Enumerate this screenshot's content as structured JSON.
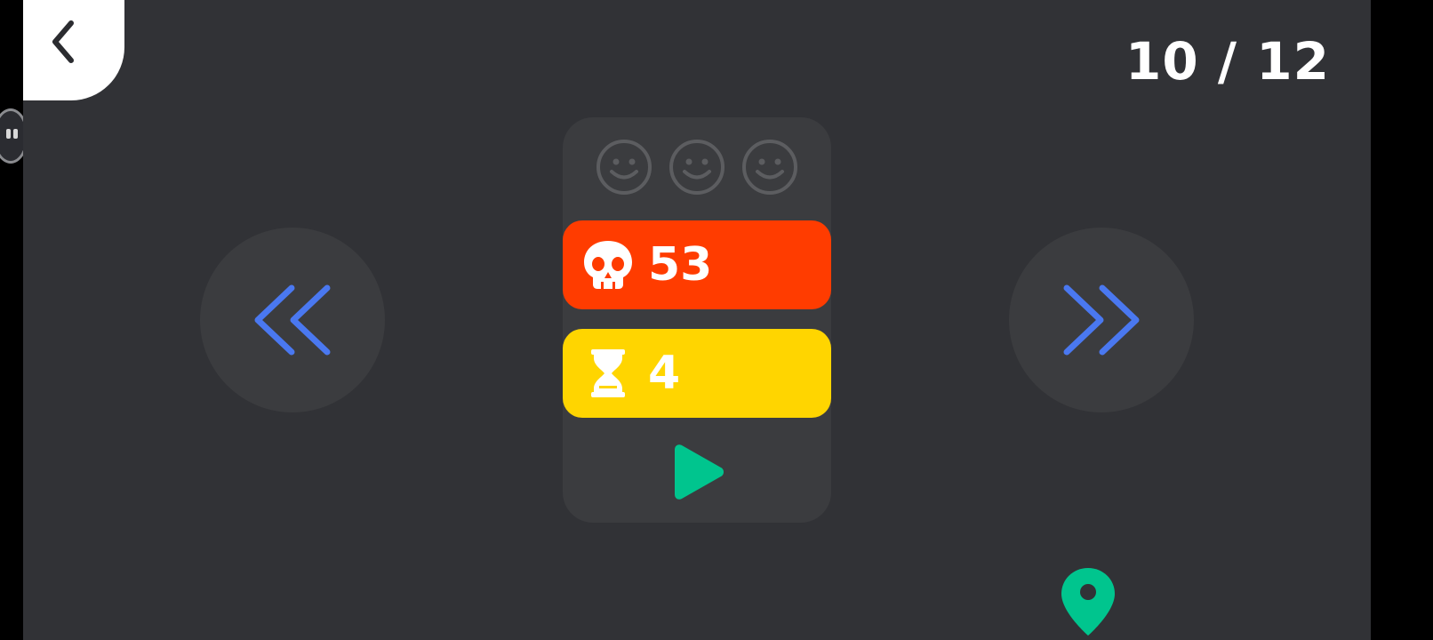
{
  "level": {
    "counter": "10 / 12"
  },
  "rating": {
    "faces_total": 3,
    "faces_earned": 0
  },
  "stats": {
    "deaths": "53",
    "time": "4"
  },
  "icons": {
    "back": "chevron-left-icon",
    "prev": "double-chevron-left-icon",
    "next": "double-chevron-right-icon",
    "deaths": "skull-icon",
    "time": "hourglass-icon",
    "play": "play-icon",
    "location": "map-pin-icon",
    "pause": "pause-icon"
  },
  "colors": {
    "background": "#313236",
    "card": "#3b3c3f",
    "deaths": "#ff3c00",
    "time": "#ffd500",
    "nav_arrow": "#4a78f0",
    "play": "#00c58e",
    "face_empty": "#5c5d60"
  }
}
